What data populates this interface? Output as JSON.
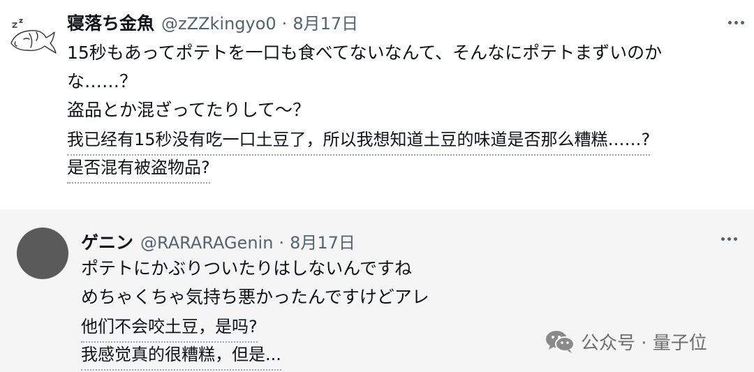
{
  "tweets": [
    {
      "name": "寝落ち金魚",
      "handle": "@zZZkingyo0",
      "separator": "·",
      "date": "8月17日",
      "lines": [
        "15秒もあってポテトを一口も食べてないなんて、そんなにポテトまずいのか",
        "な……？",
        "盗品とか混ざってたりして〜？"
      ],
      "translation": [
        "我已经有15秒没有吃一口土豆了，所以我想知道土豆的味道是否那么糟糕……?",
        "是否混有被盗物品?"
      ],
      "avatar_icon": "sleeping-goldfish-icon"
    },
    {
      "name": "ゲニン",
      "handle": "@RARARAGenin",
      "separator": "·",
      "date": "8月17日",
      "lines": [
        "ポテトにかぶりついたりはしないんですね",
        "めちゃくちゃ気持ち悪かったんですけどアレ"
      ],
      "translation": [
        "他们不会咬土豆，是吗?",
        "我感觉真的很糟糕，但是..."
      ],
      "avatar_icon": "avatar-icon"
    }
  ],
  "watermark": {
    "text": "公众号 · 量子位",
    "icon": "wechat-icon"
  },
  "colors": {
    "text": "#0f1419",
    "muted": "#536471",
    "reply_bg": "#f5f5f5"
  }
}
